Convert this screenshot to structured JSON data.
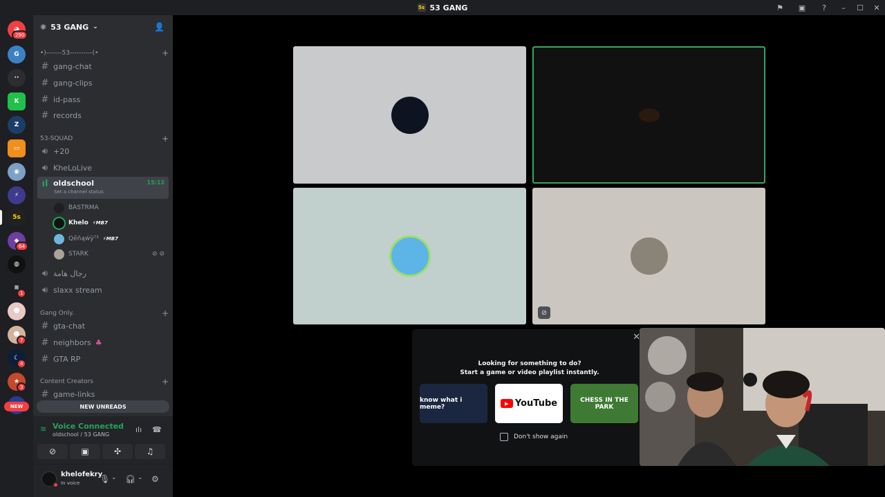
{
  "window": {
    "title": "53 GANG",
    "server_icon_text": "5s"
  },
  "titlebar_icons": [
    "inbox-icon",
    "screen-icon",
    "help-icon"
  ],
  "rail": {
    "home_badge": "290",
    "new_label": "NEW",
    "badges": [
      "64",
      "1",
      "7",
      "4",
      "3"
    ]
  },
  "server": {
    "name": "53 GANG"
  },
  "categories": {
    "top": "•)-------53----------(•",
    "squad": "53-SQUAD",
    "gang_only": "Gang Only.",
    "content": "Content Creators"
  },
  "channels": {
    "gang_chat": "gang-chat",
    "gang_clips": "gang-clips",
    "id_pass": "id-pass",
    "records": "records",
    "plus20": "+20",
    "khelolive": "KheLoLive",
    "oldschool": "oldschool",
    "oldschool_time": "15:12",
    "oldschool_status": "Set a channel status",
    "rgal": "رجال هامة",
    "slaxx": "slaxx stream",
    "gta_chat": "gta-chat",
    "neighbors": "neighbors",
    "gta_rp": "GTA RP",
    "game_links": "game-links"
  },
  "voice_users": [
    {
      "name": "BASTRMA",
      "tag": ""
    },
    {
      "name": "Khelo",
      "tag": "⚡MB7"
    },
    {
      "name": "Qẽňąẃÿ⁷³",
      "tag": "⚡MB7"
    },
    {
      "name": "STARK",
      "tag": ""
    }
  ],
  "new_unreads": "NEW UNREADS",
  "voice": {
    "title": "Voice Connected",
    "sub": "oldschool / 53 GANG"
  },
  "user": {
    "name": "khelofekry",
    "status": "In voice"
  },
  "activity": {
    "line1": "Looking for something to do?",
    "line2": "Start a game or video playlist instantly.",
    "card1": "know what i meme?",
    "card2": "YouTube",
    "card3": "CHESS IN THE PARK",
    "dont_show": "Don't show again"
  },
  "colors": {
    "accent_green": "#23a55a",
    "danger": "#f23f43",
    "bg": "#2b2d31"
  }
}
